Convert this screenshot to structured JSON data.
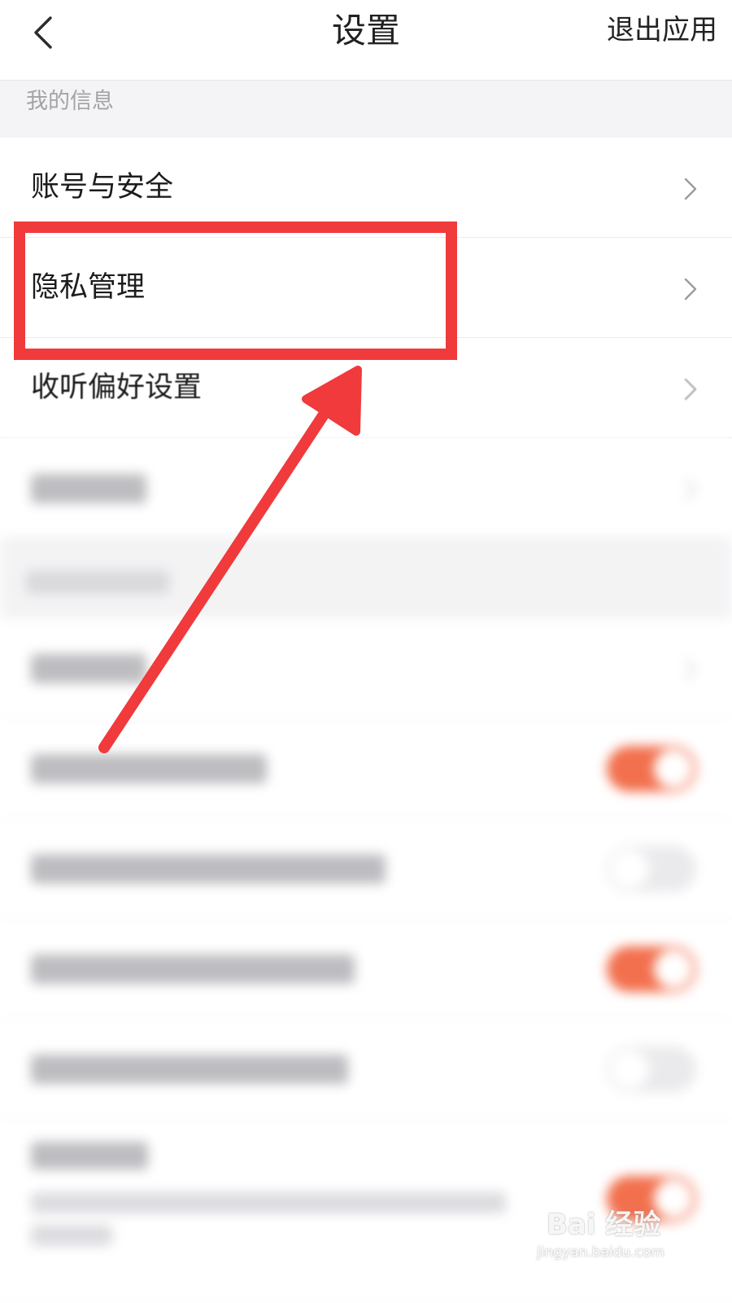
{
  "header": {
    "title": "设置",
    "exit_label": "退出应用",
    "back_icon": "back-chevron-icon"
  },
  "section_my_info": {
    "label": "我的信息",
    "items": [
      {
        "label": "账号与安全",
        "icon": "chevron-right-icon"
      },
      {
        "label": "隐私管理",
        "icon": "chevron-right-icon"
      },
      {
        "label": "收听偏好设置",
        "icon": "chevron-right-icon"
      }
    ]
  },
  "annotation": {
    "highlight_color": "#f03a3c",
    "highlighted_item": "隐私管理"
  },
  "colors": {
    "toggle_on": "#f2643f",
    "section_bg": "#f4f4f6",
    "header_text": "#222222"
  },
  "watermark": {
    "brand": "Bai 经验",
    "url": "jingyan.baidu.com"
  }
}
